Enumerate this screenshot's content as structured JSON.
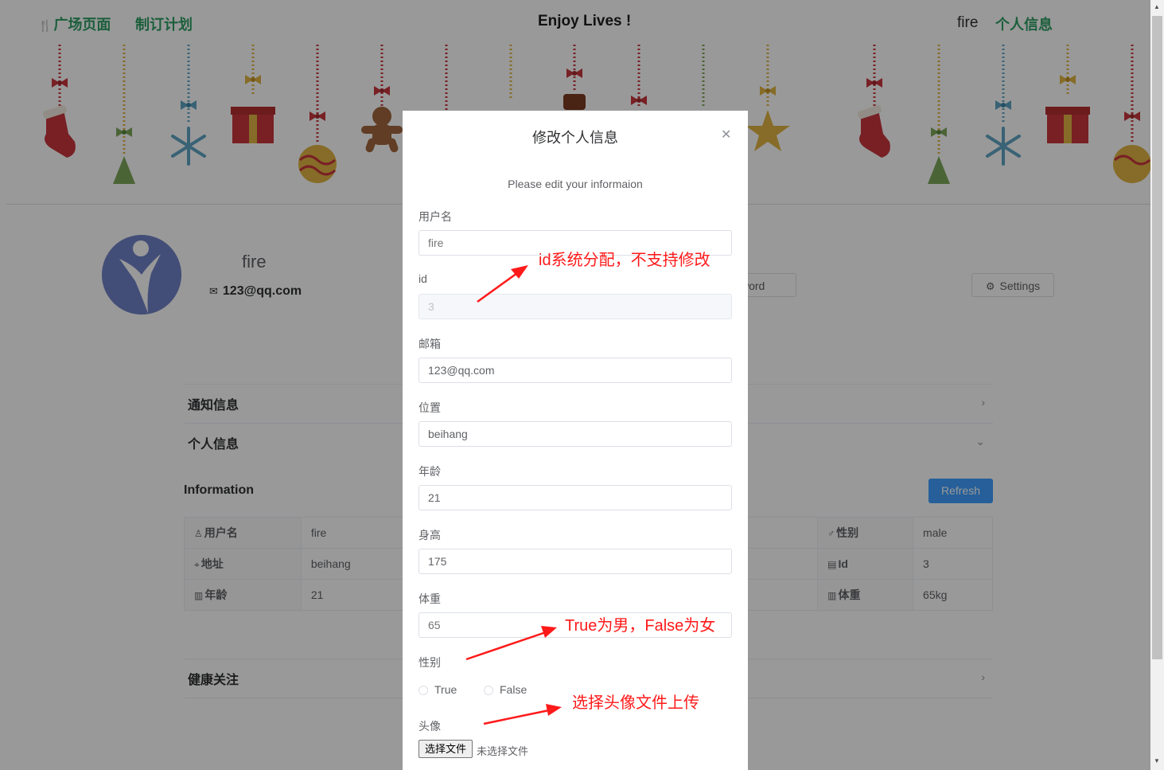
{
  "nav": {
    "home_label": "广场页面",
    "plan_label": "制订计划",
    "site_title": "Enjoy Lives !",
    "username": "fire",
    "profile_label": "个人信息"
  },
  "profile": {
    "name": "fire",
    "email": "123@qq.com",
    "password_button": "ssword",
    "settings_button": "Settings"
  },
  "collapse": {
    "notify": "通知信息",
    "personal": "个人信息",
    "health": "健康关注"
  },
  "information": {
    "title": "Information",
    "refresh": "Refresh",
    "rows": [
      [
        {
          "label": "用户名",
          "value": "fire",
          "icon": "user-icon"
        },
        {
          "label": "性别",
          "value": "male",
          "icon": "male-icon"
        }
      ],
      [
        {
          "label": "地址",
          "value": "beihang",
          "icon": "location-icon"
        },
        {
          "label": "Id",
          "value": "3",
          "icon": "id-icon"
        }
      ],
      [
        {
          "label": "年龄",
          "value": "21",
          "icon": "document-icon"
        },
        {
          "label": "体重",
          "value": "65kg",
          "icon": "document-icon"
        }
      ]
    ]
  },
  "modal": {
    "title": "修改个人信息",
    "subtitle": "Please edit your informaion",
    "fields": {
      "username": {
        "label": "用户名",
        "placeholder": "fire"
      },
      "id": {
        "label": "id",
        "value": "3"
      },
      "email": {
        "label": "邮箱",
        "value": "123@qq.com"
      },
      "location": {
        "label": "位置",
        "value": "beihang"
      },
      "age": {
        "label": "年龄",
        "value": "21"
      },
      "height": {
        "label": "身高",
        "value": "175"
      },
      "weight": {
        "label": "体重",
        "placeholder": "65"
      },
      "gender": {
        "label": "性别",
        "options": [
          "True",
          "False"
        ]
      },
      "avatar": {
        "label": "头像",
        "button": "选择文件",
        "no_file": "未选择文件"
      }
    }
  },
  "annotations": {
    "id_note": "id系统分配，不支持修改",
    "gender_note": "True为男，False为女",
    "avatar_note": "选择头像文件上传"
  },
  "colors": {
    "nav_green": "#2f9e65",
    "primary_blue": "#409eff",
    "annotation_red": "#ff1a1a",
    "overlay": "rgba(0,0,0,0.4)"
  }
}
